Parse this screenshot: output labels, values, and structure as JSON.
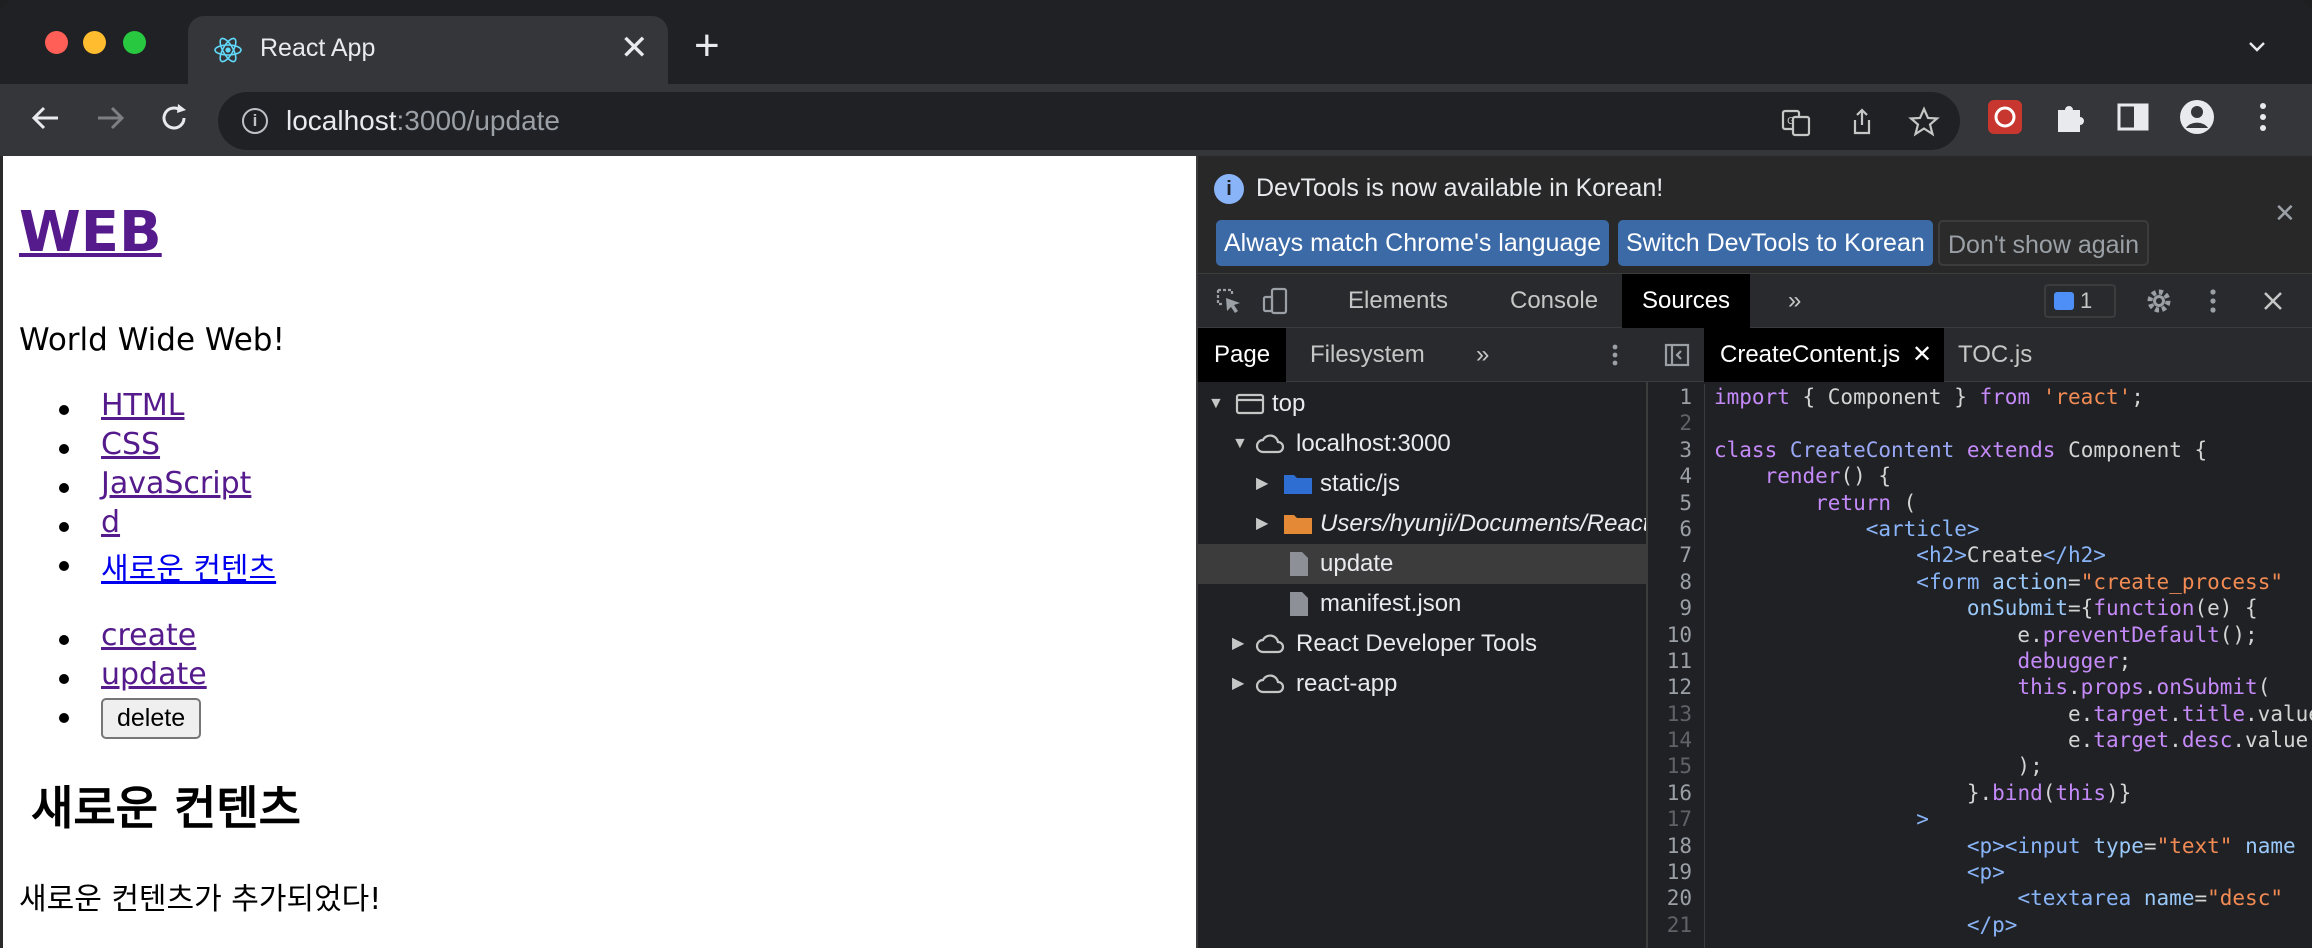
{
  "browser": {
    "tab_title": "React App",
    "tab_close": "✕",
    "new_tab": "+",
    "url_host": "localhost",
    "url_rest": ":3000/update"
  },
  "page": {
    "heading": "WEB",
    "tagline": "World Wide Web!",
    "toc": [
      "HTML",
      "CSS",
      "JavaScript",
      "d",
      " 새로운 컨텐츠"
    ],
    "actions": {
      "create": "create",
      "update": "update",
      "delete": "delete"
    },
    "content_title": "새로운 컨텐츠",
    "content_desc": "새로운 컨텐츠가 추가되었다!"
  },
  "devtools": {
    "infobar": {
      "message": "DevTools is now available in Korean!",
      "btn_match": "Always match Chrome's language",
      "btn_switch": "Switch DevTools to Korean",
      "btn_dismiss": "Don't show again",
      "close": "✕"
    },
    "tabs": [
      "Elements",
      "Console",
      "Sources"
    ],
    "more_tabs": "»",
    "issues_count": "1",
    "navigator": {
      "tabs": [
        "Page",
        "Filesystem"
      ],
      "more": "»",
      "tree": [
        {
          "label": "top",
          "type": "frame"
        },
        {
          "label": "localhost:3000",
          "type": "cloud"
        },
        {
          "label": "static/js",
          "type": "folder-blue"
        },
        {
          "label": "Users/hyunji/Documents/React",
          "type": "folder-orange"
        },
        {
          "label": "update",
          "type": "file"
        },
        {
          "label": "manifest.json",
          "type": "file"
        },
        {
          "label": "React Developer Tools",
          "type": "cloud"
        },
        {
          "label": "react-app",
          "type": "cloud"
        }
      ]
    },
    "editor": {
      "tabs": [
        "CreateContent.js",
        "TOC.js"
      ],
      "tab_close": "✕",
      "line_numbers": [
        "1",
        "2",
        "3",
        "4",
        "5",
        "6",
        "7",
        "8",
        "9",
        "10",
        "11",
        "12",
        "13",
        "14",
        "15",
        "16",
        "17",
        "18",
        "19",
        "20",
        "21"
      ]
    }
  },
  "colors": {
    "link_visited": "#551a8b",
    "link_unvisited": "#0000ee",
    "devtools_primary_button": "#3b6aa6"
  }
}
